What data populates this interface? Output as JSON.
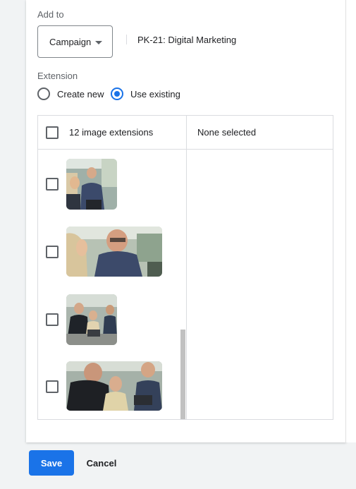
{
  "form": {
    "add_to_label": "Add to",
    "level_select": {
      "value": "Campaign"
    },
    "campaign_name": "PK-21: Digital Marketing",
    "extension_label": "Extension",
    "radios": [
      {
        "label": "Create new",
        "selected": false
      },
      {
        "label": "Use existing",
        "selected": true
      }
    ]
  },
  "table": {
    "available_header": "12 image extensions",
    "selected_header": "None selected",
    "items": [
      {
        "icon": "image-thumbnail",
        "checked": false
      },
      {
        "icon": "image-thumbnail",
        "checked": false
      },
      {
        "icon": "image-thumbnail",
        "checked": false
      },
      {
        "icon": "image-thumbnail",
        "checked": false
      }
    ]
  },
  "footer": {
    "save_label": "Save",
    "cancel_label": "Cancel"
  },
  "colors": {
    "primary": "#1a73e8",
    "border": "#dadce0",
    "background": "#f1f3f4"
  }
}
